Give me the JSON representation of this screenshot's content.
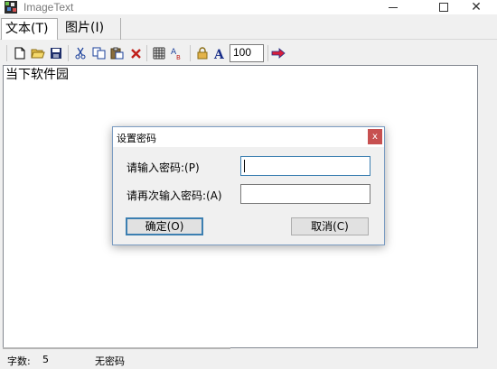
{
  "window": {
    "title": "ImageText"
  },
  "tabs": [
    {
      "label": "文本(T)"
    },
    {
      "label": "图片(I)"
    }
  ],
  "toolbar": {
    "icons": [
      "new-file-icon",
      "open-folder-icon",
      "save-icon",
      "cut-icon",
      "copy-icon",
      "paste-icon",
      "delete-icon",
      "grid-icon",
      "text-color-icon",
      "lock-icon",
      "font-icon",
      "arrow-right-icon"
    ],
    "zoom_value": "100"
  },
  "editor": {
    "text": "当下软件园"
  },
  "status": {
    "char_count_label": "字数:",
    "char_count_value": "5",
    "password_status": "无密码"
  },
  "dialog": {
    "title": "设置密码",
    "close_label": "x",
    "password_label": "请输入密码:(P)",
    "confirm_label": "请再次输入密码:(A)",
    "ok_label": "确定(O)",
    "cancel_label": "取消(C)"
  },
  "colors": {
    "accent": "#3c7fb1",
    "close_button": "#c75050"
  }
}
